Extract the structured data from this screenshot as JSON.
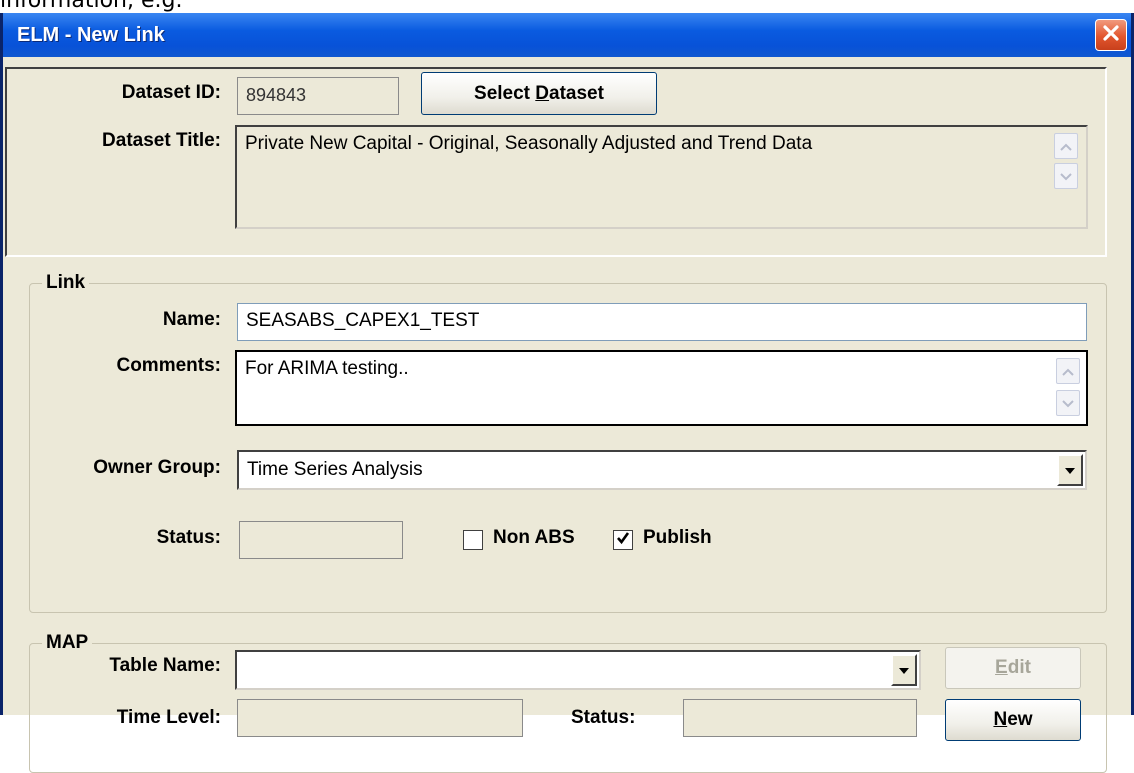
{
  "page_fragment": "information, e.g.",
  "window": {
    "title": "ELM - New Link"
  },
  "dataset": {
    "id_label": "Dataset ID:",
    "id_value": "894843",
    "select_button": {
      "before": "Select ",
      "mnemonic": "D",
      "after": "ataset"
    },
    "title_label": "Dataset Title:",
    "title_value": "Private New Capital - Original, Seasonally Adjusted and Trend Data"
  },
  "link": {
    "group_title": "Link",
    "name_label": "Name:",
    "name_value": "SEASABS_CAPEX1_TEST",
    "comments_label": "Comments:",
    "comments_value": "For ARIMA testing..",
    "owner_label": "Owner Group:",
    "owner_value": "Time Series Analysis",
    "status_label": "Status:",
    "status_value": "",
    "non_abs_label": "Non ABS",
    "non_abs_checked": false,
    "publish_label": "Publish",
    "publish_checked": true
  },
  "map": {
    "group_title": "MAP",
    "table_name_label": "Table Name:",
    "table_name_value": "",
    "time_level_label": "Time Level:",
    "time_level_value": "",
    "status_label": "Status:",
    "status_value": "",
    "edit_button": {
      "mnemonic": "E",
      "after": "dit"
    },
    "new_button": {
      "mnemonic": "N",
      "after": "ew"
    }
  },
  "icons": {
    "close": "close-icon",
    "scroll_up": "scroll-up-icon",
    "scroll_down": "scroll-down-icon",
    "dropdown": "chevron-down-icon",
    "checkmark": "checkmark-icon"
  },
  "colors": {
    "titlebar": "#0852d8",
    "window_bg": "#ece9d8",
    "close_button": "#e2562e"
  }
}
